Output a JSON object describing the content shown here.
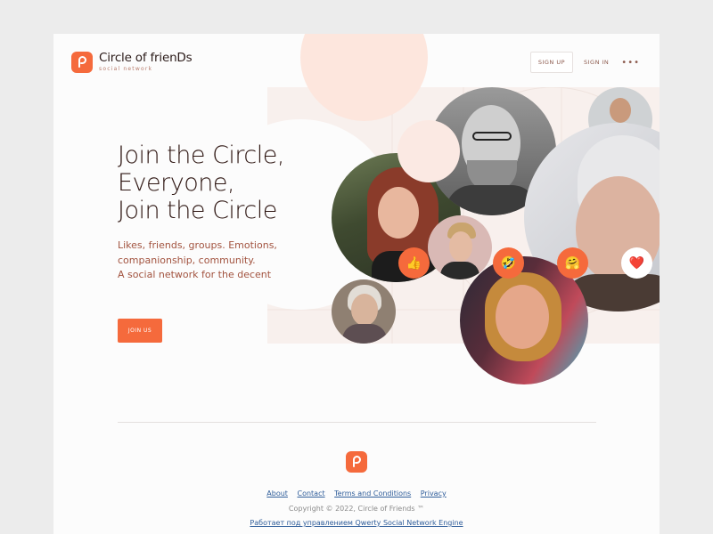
{
  "brand": {
    "name": "Circle of frienDs",
    "tagline": "social network",
    "accent": "#f56a3c"
  },
  "nav": {
    "signup": "SIGN UP",
    "signin": "SIGN IN",
    "more": "•••"
  },
  "hero": {
    "line1": "Join the Circle,",
    "line2": "Everyone,",
    "line3": "Join the Circle",
    "sub1": "Likes, friends, groups. Emotions,",
    "sub2": "companionship, community.",
    "sub3": "A social network for the decent",
    "cta": "JOIN US"
  },
  "reactions": {
    "thumbs": "👍",
    "laugh": "🤣",
    "hug": "🤗",
    "heart": "❤️"
  },
  "footer": {
    "links": [
      "About",
      "Contact",
      "Terms and Conditions",
      "Privacy"
    ],
    "copyright": "Copyright © 2022, Circle of Friends ™",
    "powered": "Работает под управлением Qwerty Social Network Engine"
  }
}
